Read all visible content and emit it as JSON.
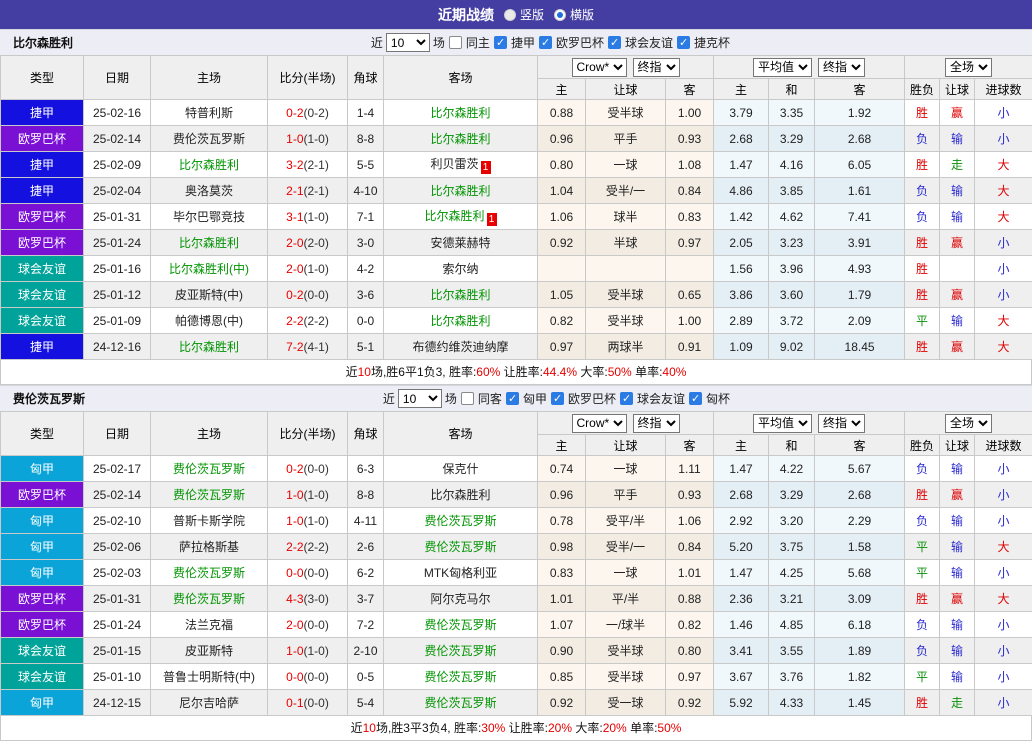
{
  "title_bar": {
    "title": "近期战绩",
    "radios": [
      {
        "label": "竖版",
        "selected": false
      },
      {
        "label": "横版",
        "selected": true
      }
    ]
  },
  "table_columns": {
    "left": [
      "类型",
      "日期",
      "主场",
      "比分(半场)",
      "角球",
      "客场"
    ],
    "sub": [
      "主",
      "让球",
      "客",
      "主",
      "和",
      "客",
      "胜负",
      "让球",
      "进球数"
    ],
    "selects": {
      "odds_source": "Crow*",
      "final_1": "终指",
      "average": "平均值",
      "final_2": "终指",
      "scope": "全场"
    }
  },
  "league_colors": {
    "捷甲": "#1411e0",
    "欧罗巴杯": "#7b10d5",
    "球会友谊": "#00a39a",
    "匈甲": "#0ba4d9"
  },
  "result_colors": {
    "胜": "#e00000",
    "负": "#2a2ad0",
    "平": "#0a910a",
    "赢": "#e00000",
    "输": "#2a2ad0",
    "走": "#0a910a",
    "大": "#e00000",
    "小": "#2a2ad0"
  },
  "sections": [
    {
      "team": "比尔森胜利",
      "filter": {
        "prefix": "近",
        "count": "10",
        "suffix": "场",
        "same_label": "同主",
        "same_checked": false,
        "leagues": [
          {
            "label": "捷甲",
            "checked": true
          },
          {
            "label": "欧罗巴杯",
            "checked": true
          },
          {
            "label": "球会友谊",
            "checked": true
          },
          {
            "label": "捷克杯",
            "checked": true
          }
        ]
      },
      "rows": [
        {
          "league": "捷甲",
          "date": "25-02-16",
          "home": {
            "name": "特普利斯",
            "highlight": false,
            "red_card": false
          },
          "score": {
            "full": "0-2",
            "half": "(0-2)"
          },
          "corner": "1-4",
          "away": {
            "name": "比尔森胜利",
            "highlight": true,
            "red_card": false
          },
          "odds": [
            "0.88",
            "受半球",
            "1.00"
          ],
          "average": [
            "3.79",
            "3.35",
            "1.92"
          ],
          "results": [
            "胜",
            "赢",
            "小"
          ]
        },
        {
          "league": "欧罗巴杯",
          "date": "25-02-14",
          "home": {
            "name": "费伦茨瓦罗斯",
            "highlight": false,
            "red_card": false
          },
          "score": {
            "full": "1-0",
            "half": "(1-0)"
          },
          "corner": "8-8",
          "away": {
            "name": "比尔森胜利",
            "highlight": true,
            "red_card": false
          },
          "odds": [
            "0.96",
            "平手",
            "0.93"
          ],
          "average": [
            "2.68",
            "3.29",
            "2.68"
          ],
          "results": [
            "负",
            "输",
            "小"
          ]
        },
        {
          "league": "捷甲",
          "date": "25-02-09",
          "home": {
            "name": "比尔森胜利",
            "highlight": true,
            "red_card": false
          },
          "score": {
            "full": "3-2",
            "half": "(2-1)"
          },
          "corner": "5-5",
          "away": {
            "name": "利贝雷茨",
            "highlight": false,
            "red_card": true
          },
          "odds": [
            "0.80",
            "一球",
            "1.08"
          ],
          "average": [
            "1.47",
            "4.16",
            "6.05"
          ],
          "results": [
            "胜",
            "走",
            "大"
          ]
        },
        {
          "league": "捷甲",
          "date": "25-02-04",
          "home": {
            "name": "奥洛莫茨",
            "highlight": false,
            "red_card": false
          },
          "score": {
            "full": "2-1",
            "half": "(2-1)"
          },
          "corner": "4-10",
          "away": {
            "name": "比尔森胜利",
            "highlight": true,
            "red_card": false
          },
          "odds": [
            "1.04",
            "受半/一",
            "0.84"
          ],
          "average": [
            "4.86",
            "3.85",
            "1.61"
          ],
          "results": [
            "负",
            "输",
            "大"
          ]
        },
        {
          "league": "欧罗巴杯",
          "date": "25-01-31",
          "home": {
            "name": "毕尔巴鄂竞技",
            "highlight": false,
            "red_card": false
          },
          "score": {
            "full": "3-1",
            "half": "(1-0)"
          },
          "corner": "7-1",
          "away": {
            "name": "比尔森胜利",
            "highlight": true,
            "red_card": true
          },
          "odds": [
            "1.06",
            "球半",
            "0.83"
          ],
          "average": [
            "1.42",
            "4.62",
            "7.41"
          ],
          "results": [
            "负",
            "输",
            "大"
          ]
        },
        {
          "league": "欧罗巴杯",
          "date": "25-01-24",
          "home": {
            "name": "比尔森胜利",
            "highlight": true,
            "red_card": false
          },
          "score": {
            "full": "2-0",
            "half": "(2-0)"
          },
          "corner": "3-0",
          "away": {
            "name": "安德莱赫特",
            "highlight": false,
            "red_card": false
          },
          "odds": [
            "0.92",
            "半球",
            "0.97"
          ],
          "average": [
            "2.05",
            "3.23",
            "3.91"
          ],
          "results": [
            "胜",
            "赢",
            "小"
          ]
        },
        {
          "league": "球会友谊",
          "date": "25-01-16",
          "home": {
            "name": "比尔森胜利(中)",
            "highlight": true,
            "red_card": false
          },
          "score": {
            "full": "2-0",
            "half": "(1-0)"
          },
          "corner": "4-2",
          "away": {
            "name": "索尔纳",
            "highlight": false,
            "red_card": false
          },
          "odds": [
            "",
            "",
            ""
          ],
          "average": [
            "1.56",
            "3.96",
            "4.93"
          ],
          "results": [
            "胜",
            "",
            "小"
          ]
        },
        {
          "league": "球会友谊",
          "date": "25-01-12",
          "home": {
            "name": "皮亚斯特(中)",
            "highlight": false,
            "red_card": false
          },
          "score": {
            "full": "0-2",
            "half": "(0-0)"
          },
          "corner": "3-6",
          "away": {
            "name": "比尔森胜利",
            "highlight": true,
            "red_card": false
          },
          "odds": [
            "1.05",
            "受半球",
            "0.65"
          ],
          "average": [
            "3.86",
            "3.60",
            "1.79"
          ],
          "results": [
            "胜",
            "赢",
            "小"
          ]
        },
        {
          "league": "球会友谊",
          "date": "25-01-09",
          "home": {
            "name": "帕德博恩(中)",
            "highlight": false,
            "red_card": false
          },
          "score": {
            "full": "2-2",
            "half": "(2-2)"
          },
          "corner": "0-0",
          "away": {
            "name": "比尔森胜利",
            "highlight": true,
            "red_card": false
          },
          "odds": [
            "0.82",
            "受半球",
            "1.00"
          ],
          "average": [
            "2.89",
            "3.72",
            "2.09"
          ],
          "results": [
            "平",
            "输",
            "大"
          ]
        },
        {
          "league": "捷甲",
          "date": "24-12-16",
          "home": {
            "name": "比尔森胜利",
            "highlight": true,
            "red_card": false
          },
          "score": {
            "full": "7-2",
            "half": "(4-1)"
          },
          "corner": "5-1",
          "away": {
            "name": "布德约维茨迪纳摩",
            "highlight": false,
            "red_card": false
          },
          "odds": [
            "0.97",
            "两球半",
            "0.91"
          ],
          "average": [
            "1.09",
            "9.02",
            "18.45"
          ],
          "results": [
            "胜",
            "赢",
            "大"
          ]
        }
      ],
      "summary": [
        {
          "t": "近",
          "red": false
        },
        {
          "t": "10",
          "red": true
        },
        {
          "t": "场,胜6平1负3, 胜率:",
          "red": false
        },
        {
          "t": "60%",
          "red": true
        },
        {
          "t": " 让胜率:",
          "red": false
        },
        {
          "t": "44.4%",
          "red": true
        },
        {
          "t": " 大率:",
          "red": false
        },
        {
          "t": "50%",
          "red": true
        },
        {
          "t": " 单率:",
          "red": false
        },
        {
          "t": "40%",
          "red": true
        }
      ]
    },
    {
      "team": "费伦茨瓦罗斯",
      "filter": {
        "prefix": "近",
        "count": "10",
        "suffix": "场",
        "same_label": "同客",
        "same_checked": false,
        "leagues": [
          {
            "label": "匈甲",
            "checked": true
          },
          {
            "label": "欧罗巴杯",
            "checked": true
          },
          {
            "label": "球会友谊",
            "checked": true
          },
          {
            "label": "匈杯",
            "checked": true
          }
        ]
      },
      "rows": [
        {
          "league": "匈甲",
          "date": "25-02-17",
          "home": {
            "name": "费伦茨瓦罗斯",
            "highlight": true,
            "red_card": false
          },
          "score": {
            "full": "0-2",
            "half": "(0-0)"
          },
          "corner": "6-3",
          "away": {
            "name": "保克什",
            "highlight": false,
            "red_card": false
          },
          "odds": [
            "0.74",
            "一球",
            "1.11"
          ],
          "average": [
            "1.47",
            "4.22",
            "5.67"
          ],
          "results": [
            "负",
            "输",
            "小"
          ]
        },
        {
          "league": "欧罗巴杯",
          "date": "25-02-14",
          "home": {
            "name": "费伦茨瓦罗斯",
            "highlight": true,
            "red_card": false
          },
          "score": {
            "full": "1-0",
            "half": "(1-0)"
          },
          "corner": "8-8",
          "away": {
            "name": "比尔森胜利",
            "highlight": false,
            "red_card": false
          },
          "odds": [
            "0.96",
            "平手",
            "0.93"
          ],
          "average": [
            "2.68",
            "3.29",
            "2.68"
          ],
          "results": [
            "胜",
            "赢",
            "小"
          ]
        },
        {
          "league": "匈甲",
          "date": "25-02-10",
          "home": {
            "name": "普斯卡斯学院",
            "highlight": false,
            "red_card": false
          },
          "score": {
            "full": "1-0",
            "half": "(1-0)"
          },
          "corner": "4-11",
          "away": {
            "name": "费伦茨瓦罗斯",
            "highlight": true,
            "red_card": false
          },
          "odds": [
            "0.78",
            "受平/半",
            "1.06"
          ],
          "average": [
            "2.92",
            "3.20",
            "2.29"
          ],
          "results": [
            "负",
            "输",
            "小"
          ]
        },
        {
          "league": "匈甲",
          "date": "25-02-06",
          "home": {
            "name": "萨拉格斯基",
            "highlight": false,
            "red_card": false
          },
          "score": {
            "full": "2-2",
            "half": "(2-2)"
          },
          "corner": "2-6",
          "away": {
            "name": "费伦茨瓦罗斯",
            "highlight": true,
            "red_card": false
          },
          "odds": [
            "0.98",
            "受半/一",
            "0.84"
          ],
          "average": [
            "5.20",
            "3.75",
            "1.58"
          ],
          "results": [
            "平",
            "输",
            "大"
          ]
        },
        {
          "league": "匈甲",
          "date": "25-02-03",
          "home": {
            "name": "费伦茨瓦罗斯",
            "highlight": true,
            "red_card": false
          },
          "score": {
            "full": "0-0",
            "half": "(0-0)"
          },
          "corner": "6-2",
          "away": {
            "name": "MTK匈格利亚",
            "highlight": false,
            "red_card": false
          },
          "odds": [
            "0.83",
            "一球",
            "1.01"
          ],
          "average": [
            "1.47",
            "4.25",
            "5.68"
          ],
          "results": [
            "平",
            "输",
            "小"
          ]
        },
        {
          "league": "欧罗巴杯",
          "date": "25-01-31",
          "home": {
            "name": "费伦茨瓦罗斯",
            "highlight": true,
            "red_card": false
          },
          "score": {
            "full": "4-3",
            "half": "(3-0)"
          },
          "corner": "3-7",
          "away": {
            "name": "阿尔克马尔",
            "highlight": false,
            "red_card": false
          },
          "odds": [
            "1.01",
            "平/半",
            "0.88"
          ],
          "average": [
            "2.36",
            "3.21",
            "3.09"
          ],
          "results": [
            "胜",
            "赢",
            "大"
          ]
        },
        {
          "league": "欧罗巴杯",
          "date": "25-01-24",
          "home": {
            "name": "法兰克福",
            "highlight": false,
            "red_card": false
          },
          "score": {
            "full": "2-0",
            "half": "(0-0)"
          },
          "corner": "7-2",
          "away": {
            "name": "费伦茨瓦罗斯",
            "highlight": true,
            "red_card": false
          },
          "odds": [
            "1.07",
            "一/球半",
            "0.82"
          ],
          "average": [
            "1.46",
            "4.85",
            "6.18"
          ],
          "results": [
            "负",
            "输",
            "小"
          ]
        },
        {
          "league": "球会友谊",
          "date": "25-01-15",
          "home": {
            "name": "皮亚斯特",
            "highlight": false,
            "red_card": false
          },
          "score": {
            "full": "1-0",
            "half": "(1-0)"
          },
          "corner": "2-10",
          "away": {
            "name": "费伦茨瓦罗斯",
            "highlight": true,
            "red_card": false
          },
          "odds": [
            "0.90",
            "受半球",
            "0.80"
          ],
          "average": [
            "3.41",
            "3.55",
            "1.89"
          ],
          "results": [
            "负",
            "输",
            "小"
          ]
        },
        {
          "league": "球会友谊",
          "date": "25-01-10",
          "home": {
            "name": "普鲁士明斯特(中)",
            "highlight": false,
            "red_card": false
          },
          "score": {
            "full": "0-0",
            "half": "(0-0)"
          },
          "corner": "0-5",
          "away": {
            "name": "费伦茨瓦罗斯",
            "highlight": true,
            "red_card": false
          },
          "odds": [
            "0.85",
            "受半球",
            "0.97"
          ],
          "average": [
            "3.67",
            "3.76",
            "1.82"
          ],
          "results": [
            "平",
            "输",
            "小"
          ]
        },
        {
          "league": "匈甲",
          "date": "24-12-15",
          "home": {
            "name": "尼尔吉哈萨",
            "highlight": false,
            "red_card": false
          },
          "score": {
            "full": "0-1",
            "half": "(0-0)"
          },
          "corner": "5-4",
          "away": {
            "name": "费伦茨瓦罗斯",
            "highlight": true,
            "red_card": false
          },
          "odds": [
            "0.92",
            "受一球",
            "0.92"
          ],
          "average": [
            "5.92",
            "4.33",
            "1.45"
          ],
          "results": [
            "胜",
            "走",
            "小"
          ]
        }
      ],
      "summary": [
        {
          "t": "近",
          "red": false
        },
        {
          "t": "10",
          "red": true
        },
        {
          "t": "场,胜3平3负4, 胜率:",
          "red": false
        },
        {
          "t": "30%",
          "red": true
        },
        {
          "t": " 让胜率:",
          "red": false
        },
        {
          "t": "20%",
          "red": true
        },
        {
          "t": " 大率:",
          "red": false
        },
        {
          "t": "20%",
          "red": true
        },
        {
          "t": " 单率:",
          "red": false
        },
        {
          "t": "50%",
          "red": true
        }
      ]
    }
  ]
}
